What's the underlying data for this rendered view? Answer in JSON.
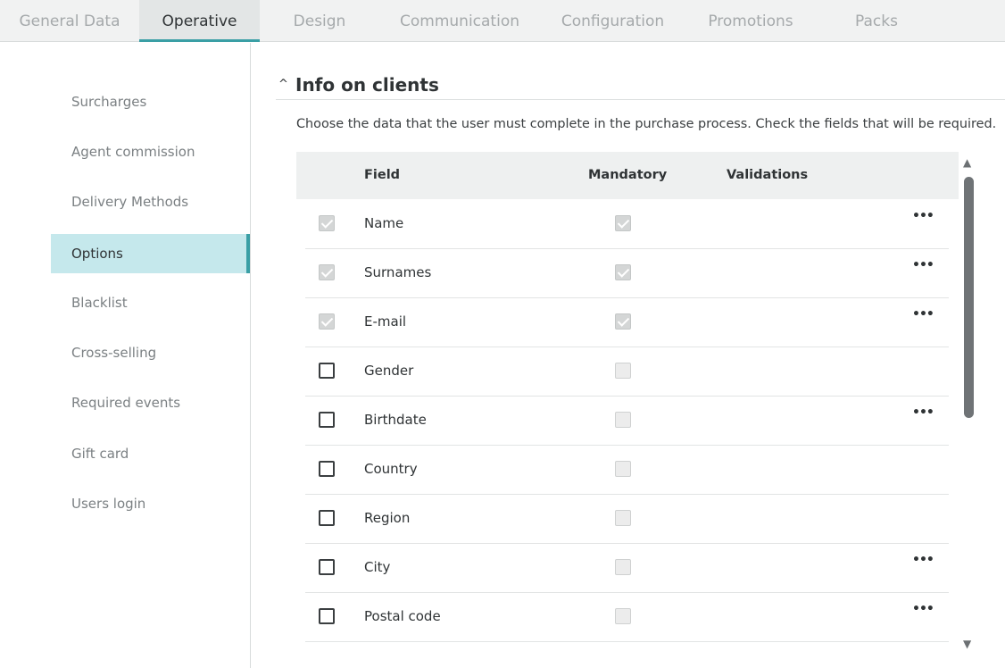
{
  "tabs": [
    {
      "label": "General Data",
      "active": false
    },
    {
      "label": "Operative",
      "active": true
    },
    {
      "label": "Design",
      "active": false
    },
    {
      "label": "Communication",
      "active": false
    },
    {
      "label": "Configuration",
      "active": false
    },
    {
      "label": "Promotions",
      "active": false
    },
    {
      "label": "Packs",
      "active": false
    }
  ],
  "sidebar": {
    "items": [
      {
        "label": "Surcharges",
        "active": false
      },
      {
        "label": "Agent commission",
        "active": false
      },
      {
        "label": "Delivery Methods",
        "active": false
      },
      {
        "label": "Options",
        "active": true
      },
      {
        "label": "Blacklist",
        "active": false
      },
      {
        "label": "Cross-selling",
        "active": false
      },
      {
        "label": "Required events",
        "active": false
      },
      {
        "label": "Gift card",
        "active": false
      },
      {
        "label": "Users login",
        "active": false
      }
    ]
  },
  "section": {
    "caret": "^",
    "title": "Info on clients",
    "description": "Choose the data that the user must complete in the purchase process. Check the fields that will be required."
  },
  "table": {
    "headers": {
      "field": "Field",
      "mandatory": "Mandatory",
      "validations": "Validations"
    },
    "rows": [
      {
        "field": "Name",
        "selected": true,
        "mandatory": true,
        "has_menu": true
      },
      {
        "field": "Surnames",
        "selected": true,
        "mandatory": true,
        "has_menu": true
      },
      {
        "field": "E-mail",
        "selected": true,
        "mandatory": true,
        "has_menu": true
      },
      {
        "field": "Gender",
        "selected": false,
        "mandatory": false,
        "has_menu": false
      },
      {
        "field": "Birthdate",
        "selected": false,
        "mandatory": false,
        "has_menu": true
      },
      {
        "field": "Country",
        "selected": false,
        "mandatory": false,
        "has_menu": false
      },
      {
        "field": "Region",
        "selected": false,
        "mandatory": false,
        "has_menu": false
      },
      {
        "field": "City",
        "selected": false,
        "mandatory": false,
        "has_menu": true
      },
      {
        "field": "Postal code",
        "selected": false,
        "mandatory": false,
        "has_menu": true
      }
    ],
    "menu_glyph": "•••"
  },
  "colors": {
    "accent": "#3a9fa5",
    "active_bg": "#c5e8ec"
  }
}
